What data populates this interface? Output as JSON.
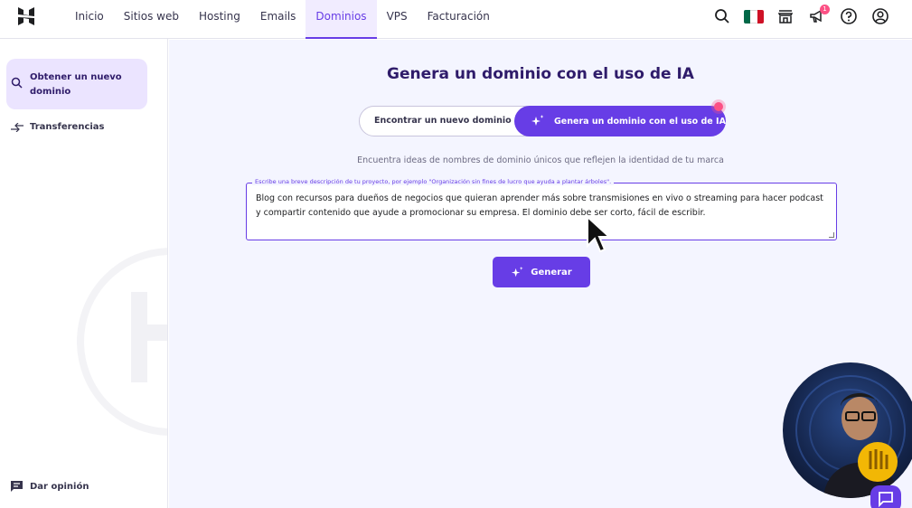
{
  "nav": {
    "items": [
      "Inicio",
      "Sitios web",
      "Hosting",
      "Emails",
      "Dominios",
      "VPS",
      "Facturación"
    ],
    "active": "Dominios",
    "notification_count": "1"
  },
  "sidebar": {
    "active_item": "Obtener un nuevo dominio",
    "transfer_item": "Transferencias",
    "feedback": "Dar opinión"
  },
  "main": {
    "title": "Genera un dominio con el uso de IA",
    "toggle_left": "Encontrar un nuevo dominio",
    "toggle_right": "Genera un dominio con el uso de IA",
    "subtitle": "Encuentra ideas de nombres de dominio únicos que reflejen la identidad de tu marca",
    "textarea_label": "Escribe una breve descripción de tu proyecto, por ejemplo \"Organización sin fines de lucro que ayuda a plantar árboles\".",
    "textarea_value": "Blog con recursos para dueños de negocios que quieran aprender más sobre transmisiones en vivo o streaming para hacer podcast y compartir contenido que ayude a promocionar su empresa. El dominio debe ser corto, fácil de escribir.",
    "generate_button": "Generar"
  },
  "colors": {
    "primary": "#673de6",
    "active_bg": "#ebe4ff",
    "main_bg": "#f4f5ff",
    "badge": "#fc5185"
  },
  "flag_colors": [
    "#006847",
    "#ffffff",
    "#ce1126"
  ]
}
